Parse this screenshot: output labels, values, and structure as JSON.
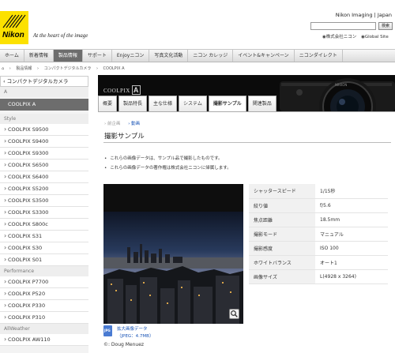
{
  "header": {
    "brand": "Nikon",
    "tagline": "At the heart of the image",
    "imaging": "Nikon Imaging | Japan",
    "search_button": "検索",
    "radio_options": [
      "◉株式会社ニコン",
      "◉Global Site"
    ]
  },
  "global_nav": [
    "ホーム",
    "新着情報",
    "製品情報",
    "サポート",
    "Enjoyニコン",
    "写真文化活動",
    "ニコン カレッジ",
    "イベント&キャンペーン",
    "ニコンダイレクト"
  ],
  "breadcrumb": [
    "⌂",
    "›",
    "製品情報",
    "›",
    "コンパクトデジタルカメラ",
    "›",
    "COOLPIX A"
  ],
  "sidebar": {
    "heading": "‹ コンパクトデジタルカメラ",
    "groups": [
      {
        "section": "A",
        "items": [
          "COOLPIX A"
        ]
      },
      {
        "section": "Style",
        "items": [
          "COOLPIX S9500",
          "COOLPIX S9400",
          "COOLPIX S9300",
          "COOLPIX S6500",
          "COOLPIX S6400",
          "COOLPIX S5200",
          "COOLPIX S3500",
          "COOLPIX S3300",
          "COOLPIX S800c",
          "COOLPIX S31",
          "COOLPIX S30",
          "COOLPIX S01"
        ]
      },
      {
        "section": "Performance",
        "items": [
          "COOLPIX P7700",
          "COOLPIX P520",
          "COOLPIX P330",
          "COOLPIX P310"
        ]
      },
      {
        "section": "AllWeather",
        "items": [
          "COOLPIX AW110"
        ]
      }
    ],
    "selected": "COOLPIX A"
  },
  "banner": {
    "product_logo": "COOLPIX",
    "product_letter": "A"
  },
  "tabs": [
    "概要",
    "製品特長",
    "主な仕様",
    "システム",
    "撮影サンプル",
    "関連製品"
  ],
  "active_tab": "撮影サンプル",
  "subnav": {
    "prev": "› 前企画",
    "next": "› 動画"
  },
  "page_title": "撮影サンプル",
  "notes": [
    "これらの画像データは、サンプル品で撮影したものです。",
    "これらの画像データの著作権は株式会社ニコンに帰属します。"
  ],
  "download": {
    "title": "拡大画像データ",
    "size": "（JPEG：4.7MB）"
  },
  "credit": "©: Doug Menuez",
  "specs": [
    {
      "label": "シャッタースピード",
      "value": "1/15秒"
    },
    {
      "label": "絞り値",
      "value": "f/5.6"
    },
    {
      "label": "焦点距離",
      "value": "18.5mm"
    },
    {
      "label": "撮影モード",
      "value": "マニュアル"
    },
    {
      "label": "撮影感度",
      "value": "ISO 100"
    },
    {
      "label": "ホワイトバランス",
      "value": "オート1"
    },
    {
      "label": "画像サイズ",
      "value": "L(4928 x 3264)"
    }
  ],
  "colors": {
    "nikon_yellow": "#fce100",
    "link_blue": "#1a55b7",
    "active_gray": "#6d6d6d"
  }
}
